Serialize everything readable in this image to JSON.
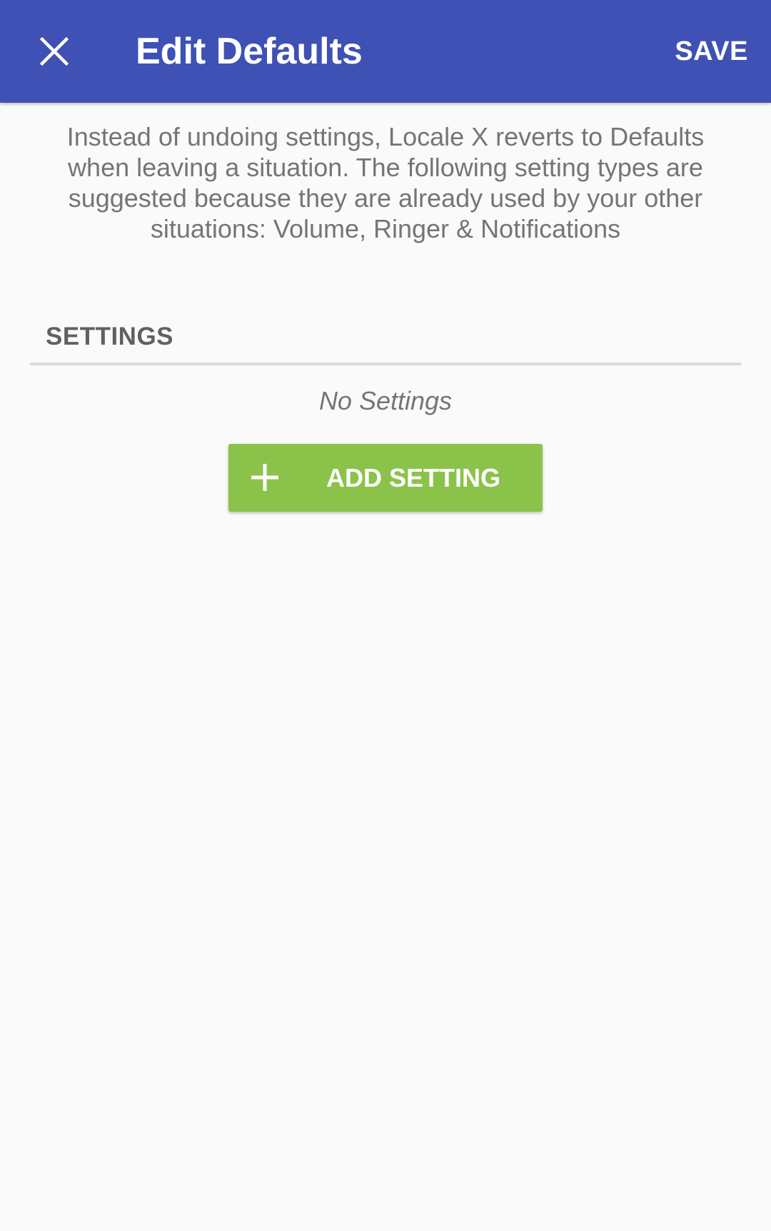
{
  "appbar": {
    "title": "Edit Defaults",
    "save_label": "SAVE",
    "close_icon": "close-icon",
    "background_color": "#3f51b5"
  },
  "description": "Instead of undoing settings, Locale X reverts to Defaults when leaving a situation. The following setting types are suggested because they are already used by your other situations: Volume, Ringer & Notifications",
  "settings_section": {
    "header": "SETTINGS",
    "empty_text": "No Settings",
    "add_button_label": "ADD SETTING",
    "add_icon": "plus-icon",
    "add_button_color": "#8bc34a"
  }
}
